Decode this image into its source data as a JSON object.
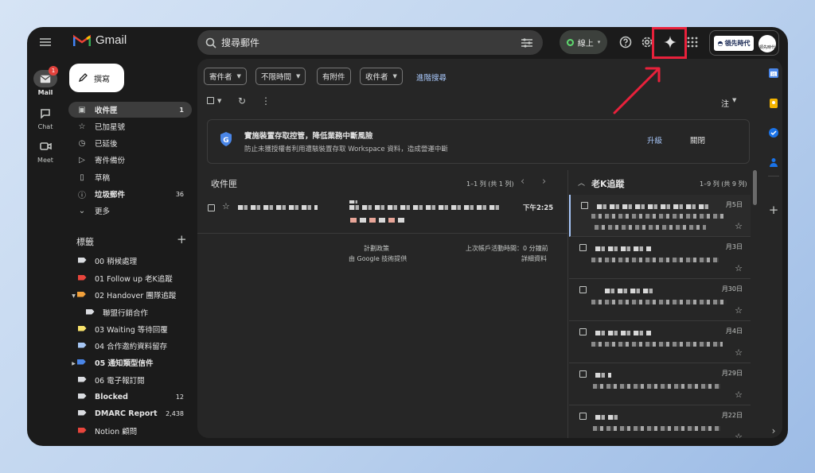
{
  "app": {
    "name": "Gmail"
  },
  "search": {
    "placeholder": "搜尋郵件"
  },
  "status": {
    "label": "線上"
  },
  "org": {
    "name": "領先時代",
    "avatar_caption": "領先時代"
  },
  "rail": [
    {
      "label": "Mail",
      "badge": "1"
    },
    {
      "label": "Chat"
    },
    {
      "label": "Meet"
    }
  ],
  "compose": {
    "label": "撰寫"
  },
  "folders": [
    {
      "label": "收件匣",
      "count": "1",
      "icon": "inbox-icon"
    },
    {
      "label": "已加星號",
      "count": "",
      "icon": "star-icon"
    },
    {
      "label": "已延後",
      "count": "",
      "icon": "clock-icon"
    },
    {
      "label": "寄件備份",
      "count": "",
      "icon": "send-icon"
    },
    {
      "label": "草稿",
      "count": "",
      "icon": "draft-icon"
    },
    {
      "label": "垃圾郵件",
      "count": "36",
      "icon": "spam-icon"
    },
    {
      "label": "更多",
      "count": "",
      "icon": "chevron-down-icon"
    }
  ],
  "labels_section": {
    "title": "標籤"
  },
  "labels": [
    {
      "label": "00 稍候處理",
      "color": "#dadce0",
      "count": ""
    },
    {
      "label": "01 Follow up 老K追蹤",
      "color": "#e8453c",
      "count": ""
    },
    {
      "label": "02 Handover 團隊追蹤",
      "color": "#f2a13b",
      "count": ""
    },
    {
      "label": "聯盟行銷合作",
      "color": "#dadce0",
      "count": ""
    },
    {
      "label": "03 Waiting 等待回覆",
      "color": "#f7e26b",
      "count": ""
    },
    {
      "label": "04 合作邀約資料留存",
      "color": "#a7c7f5",
      "count": ""
    },
    {
      "label": "05 通知類型信件",
      "color": "#4a86e8",
      "count": ""
    },
    {
      "label": "06 電子報訂閱",
      "color": "#dadce0",
      "count": ""
    },
    {
      "label": "Blocked",
      "color": "#dadce0",
      "count": "12"
    },
    {
      "label": "DMARC Report",
      "color": "#dadce0",
      "count": "2,438"
    },
    {
      "label": "Notion 顧問",
      "color": "#e8453c",
      "count": ""
    }
  ],
  "filters": [
    {
      "label": "寄件者"
    },
    {
      "label": "不限時間"
    },
    {
      "label": "有附件"
    },
    {
      "label": "收件者"
    }
  ],
  "advanced_search": "進階搜尋",
  "toolbar": {
    "input_tools": "注"
  },
  "banner": {
    "title": "實施裝置存取控管，降低業務中斷風險",
    "body": "防止未獲授權者利用遭駭裝置存取 Workspace 資料，造成營運中斷",
    "upgrade": "升級",
    "close": "關閉"
  },
  "inbox_pane": {
    "title": "收件匣",
    "range": "1–1 列 (共 1 列)",
    "first_time": "下午2:25",
    "footer_left_1": "計劃政策",
    "footer_left_2": "由 Google 技術提供",
    "footer_right_1": "上次帳戶活動時間：0 分鐘前",
    "footer_right_2": "詳細資料"
  },
  "label_pane": {
    "title": "老K追蹤",
    "range": "1–9 列 (共 9 列)",
    "dates": [
      "月5日",
      "月3日",
      "月30日",
      "月4日",
      "月29日",
      "月22日"
    ]
  },
  "colors": {
    "accent": "#a8c7fa",
    "highlight": "#e8213b",
    "online": "#5fd96f"
  }
}
